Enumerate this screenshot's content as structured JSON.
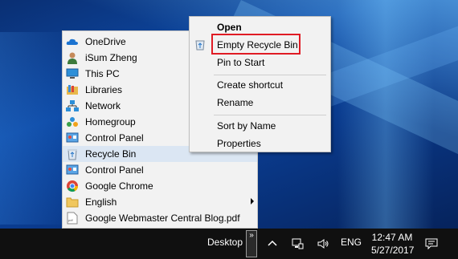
{
  "jump_list": {
    "items": [
      {
        "label": "OneDrive",
        "icon": "onedrive-icon"
      },
      {
        "label": "iSum Zheng",
        "icon": "user-icon"
      },
      {
        "label": "This PC",
        "icon": "computer-icon"
      },
      {
        "label": "Libraries",
        "icon": "libraries-icon"
      },
      {
        "label": "Network",
        "icon": "network-icon"
      },
      {
        "label": "Homegroup",
        "icon": "homegroup-icon"
      },
      {
        "label": "Control Panel",
        "icon": "control-panel-icon"
      },
      {
        "label": "Recycle Bin",
        "icon": "recycle-bin-icon"
      },
      {
        "label": "Control Panel",
        "icon": "control-panel-icon"
      },
      {
        "label": "Google Chrome",
        "icon": "chrome-icon"
      },
      {
        "label": "English",
        "icon": "folder-icon"
      },
      {
        "label": "Google Webmaster Central Blog.pdf",
        "icon": "pdf-icon"
      }
    ],
    "hovered_item": "Recycle Bin"
  },
  "context_menu": {
    "items": [
      "Open",
      "Empty Recycle Bin",
      "Pin to Start",
      "Create shortcut",
      "Rename",
      "Sort by Name",
      "Properties"
    ],
    "highlighted_item": "Empty Recycle Bin",
    "highlight_color": "#e01b24"
  },
  "taskbar": {
    "desktop_label": "Desktop",
    "expander_glyph": "»",
    "language": "ENG",
    "time": "12:47 AM",
    "date": "5/27/2017"
  },
  "colors": {
    "menu_bg": "#f2f2f2",
    "hover_bg": "#dbe6f3",
    "taskbar_bg": "#101010"
  }
}
